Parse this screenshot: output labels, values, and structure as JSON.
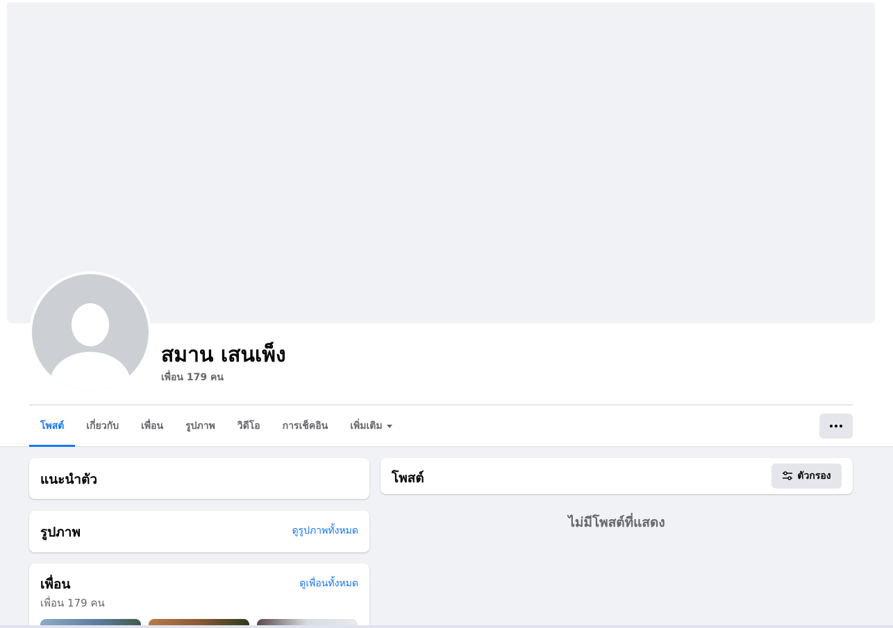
{
  "profile": {
    "name": "สมาน เสนเพ็ง",
    "friend_count_text": "เพื่อน 179 คน"
  },
  "tabs": [
    {
      "label": "โพสต์",
      "active": true
    },
    {
      "label": "เกี่ยวกับ",
      "active": false
    },
    {
      "label": "เพื่อน",
      "active": false
    },
    {
      "label": "รูปภาพ",
      "active": false
    },
    {
      "label": "วิดีโอ",
      "active": false
    },
    {
      "label": "การเช็คอิน",
      "active": false
    },
    {
      "label": "เพิ่มเติม",
      "active": false
    }
  ],
  "intro": {
    "title": "แนะนำตัว"
  },
  "photos": {
    "title": "รูปภาพ",
    "see_all": "ดูรูปภาพทั้งหมด"
  },
  "friends": {
    "title": "เพื่อน",
    "see_all": "ดูเพื่อนทั้งหมด",
    "count_text": "เพื่อน 179 คน"
  },
  "posts": {
    "title": "โพสต์",
    "filter_label": "ตัวกรอง",
    "empty_text": "ไม่มีโพสต์ที่แสดง"
  },
  "icons": {
    "more": "ellipsis-icon",
    "dropdown": "caret-down-icon",
    "filter": "filter-sliders-icon",
    "avatar": "default-avatar-icon"
  },
  "colors": {
    "accent": "#1877f2",
    "background": "#f0f2f5",
    "secondary_text": "#65676b",
    "button_bg": "#e4e6eb"
  }
}
